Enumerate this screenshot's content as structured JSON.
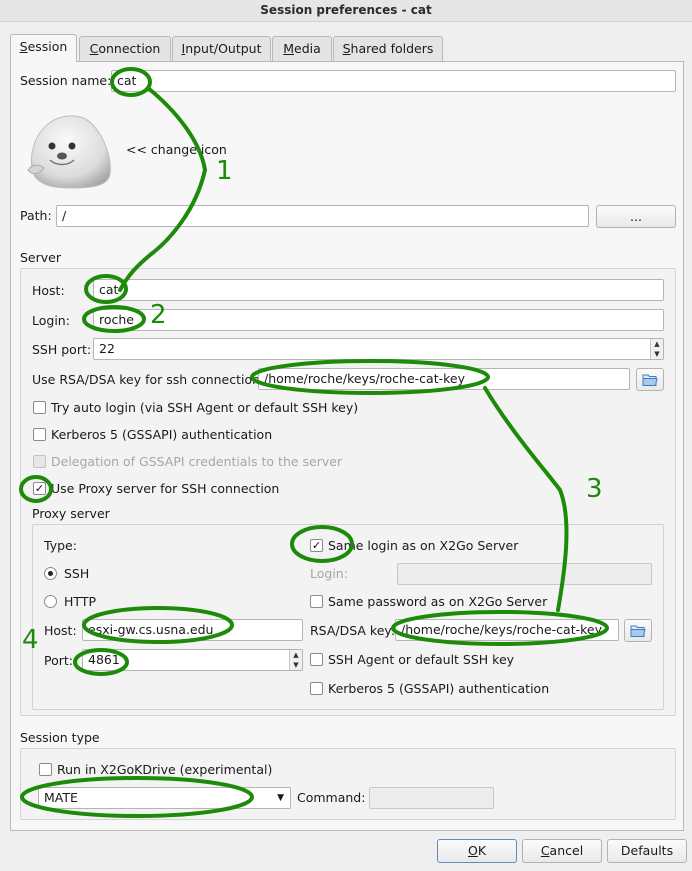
{
  "window": {
    "title": "Session preferences - cat"
  },
  "tabs": [
    {
      "label": "Session",
      "accel": "S",
      "rest": "ession"
    },
    {
      "label": "Connection",
      "accel": "C",
      "rest": "onnection"
    },
    {
      "label": "Input/Output",
      "accel": "I",
      "rest": "nput/Output"
    },
    {
      "label": "Media",
      "accel": "M",
      "rest": "edia"
    },
    {
      "label": "Shared folders",
      "accel": "S",
      "rest": "hared folders"
    }
  ],
  "session": {
    "name_label": "Session name:",
    "name_value": "cat",
    "change_icon_label": "<< change icon",
    "path_label": "Path:",
    "path_value": "/",
    "browse_label": "..."
  },
  "server": {
    "heading": "Server",
    "host_label": "Host:",
    "host_value": "cat",
    "login_label": "Login:",
    "login_value": "roche",
    "ssh_port_label": "SSH port:",
    "ssh_port_value": "22",
    "key_label": "Use RSA/DSA key for ssh connection:",
    "key_value": "/home/roche/keys/roche-cat-key",
    "auto_login": {
      "label": "Try auto login (via SSH Agent or default SSH key)",
      "checked": false
    },
    "kerberos": {
      "label": "Kerberos 5 (GSSAPI) authentication",
      "checked": false
    },
    "delegation": {
      "label": "Delegation of GSSAPI credentials to the server",
      "checked": false,
      "disabled": true
    },
    "use_proxy": {
      "label": "Use Proxy server for SSH connection",
      "checked": true
    }
  },
  "proxy": {
    "heading": "Proxy server",
    "type_label": "Type:",
    "type_options": [
      {
        "label": "SSH",
        "selected": true
      },
      {
        "label": "HTTP",
        "selected": false
      }
    ],
    "host_label": "Host:",
    "host_value": "esxi-gw.cs.usna.edu",
    "port_label": "Port:",
    "port_value": "4861",
    "same_login": {
      "label": "Same login as on X2Go Server",
      "checked": true
    },
    "login_label": "Login:",
    "login_value": "",
    "same_password": {
      "label": "Same password as on X2Go Server",
      "checked": false
    },
    "key_label": "RSA/DSA key:",
    "key_value": "/home/roche/keys/roche-cat-key",
    "ssh_agent": {
      "label": "SSH Agent or default SSH key",
      "checked": false
    },
    "kerberos": {
      "label": "Kerberos 5 (GSSAPI) authentication",
      "checked": false
    }
  },
  "session_type": {
    "heading": "Session type",
    "kdrive": {
      "label": "Run in X2GoKDrive (experimental)",
      "checked": false
    },
    "selected": "MATE",
    "command_label": "Command:",
    "command_value": ""
  },
  "buttons": {
    "ok": {
      "accel": "O",
      "rest": "K"
    },
    "cancel": {
      "accel": "C",
      "rest": "ancel"
    },
    "defaults": "Defaults"
  },
  "annotations": [
    "1",
    "2",
    "3",
    "4"
  ],
  "colors": {
    "annotation": "#1d8a0a",
    "panel": "#f7f7f7",
    "window": "#efefef"
  }
}
